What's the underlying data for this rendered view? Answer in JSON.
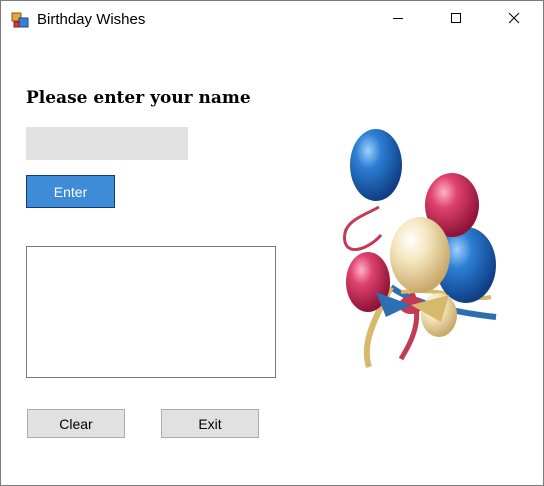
{
  "window": {
    "title": "Birthday Wishes",
    "controls": {
      "minimize_icon": "minimize-icon",
      "maximize_icon": "maximize-icon",
      "close_icon": "close-icon"
    }
  },
  "form": {
    "prompt": "Please enter your name",
    "name_input": {
      "value": "",
      "placeholder": ""
    },
    "enter_label": "Enter",
    "output_text": "",
    "clear_label": "Clear",
    "exit_label": "Exit",
    "image": "balloons-image"
  },
  "colors": {
    "enter_button": "#3e8cd8",
    "input_background": "#e1e1e1",
    "button_background": "#e1e1e1"
  }
}
